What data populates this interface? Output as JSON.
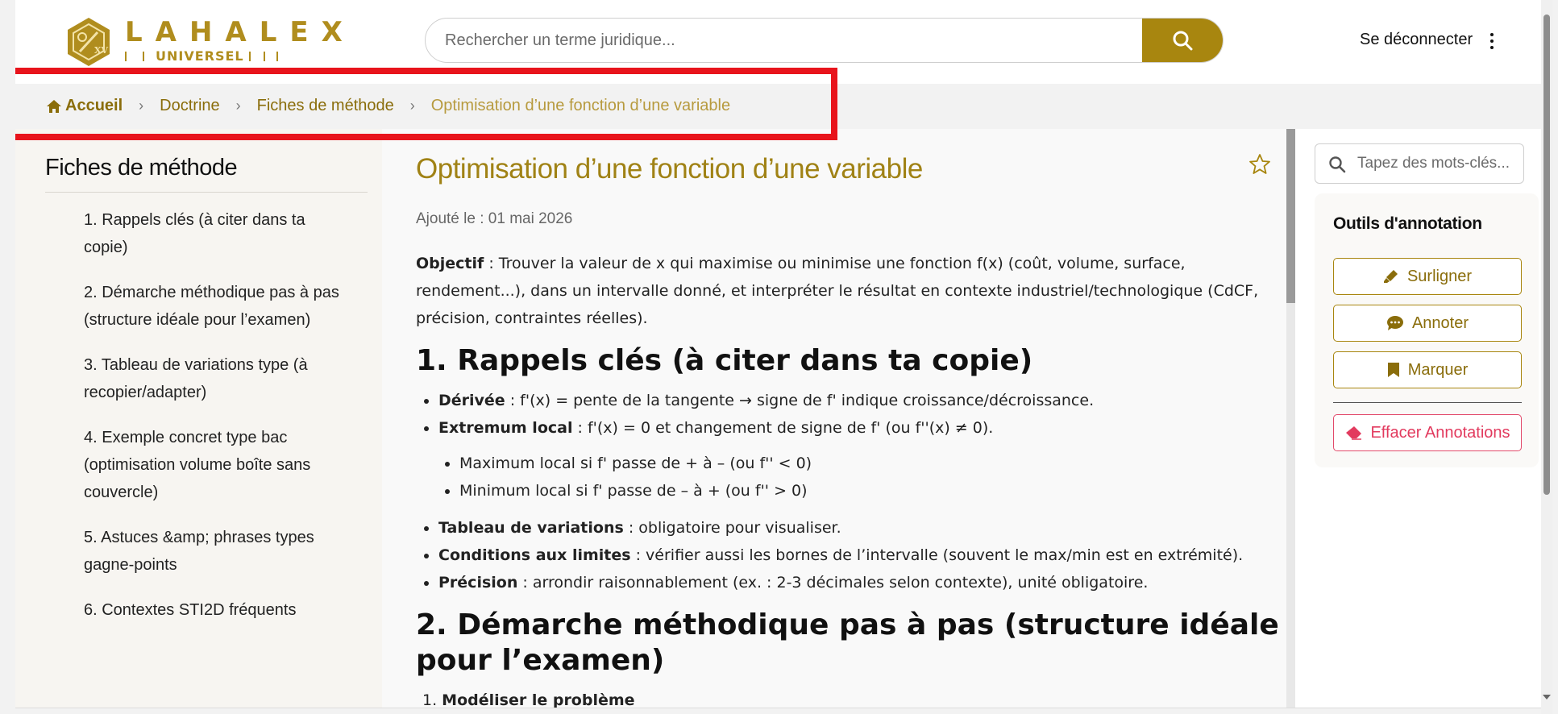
{
  "header": {
    "logo_word": "LAHALEX",
    "logo_sub": "UNIVERSEL",
    "search_placeholder": "Rechercher un terme juridique...",
    "logout_label": "Se déconnecter"
  },
  "breadcrumb": {
    "home": "Accueil",
    "items": [
      "Doctrine",
      "Fiches de méthode"
    ],
    "current": "Optimisation d’une fonction d’une variable"
  },
  "sidebar": {
    "title": "Fiches de méthode",
    "items": [
      "1. Rappels clés (à citer dans ta copie)",
      "2. Démarche méthodique pas à pas (structure idéale pour l’examen)",
      "3. Tableau de variations type (à recopier/adapter)",
      "4. Exemple concret type bac (optimisation volume boîte sans couvercle)",
      "5. Astuces &amp; phrases types gagne-points",
      "6. Contextes STI2D fréquents"
    ]
  },
  "article": {
    "title": "Optimisation d’une fonction d’une variable",
    "added": "Ajouté le : 01 mai 2026",
    "objective_label": "Objectif",
    "objective_text": " : Trouver la valeur de x qui maximise ou minimise une fonction f(x) (coût, volume, surface, rendement...), dans un intervalle donné, et interpréter le résultat en contexte industriel/technologique (CdCF, précision, contraintes réelles).",
    "h1": "1. Rappels clés (à citer dans ta copie)",
    "bullets": [
      {
        "label": "Dérivée",
        "text": " : f'(x) = pente de la tangente → signe de f' indique croissance/décroissance."
      },
      {
        "label": "Extremum local",
        "text": " : f'(x) = 0 et changement de signe de f' (ou f''(x) ≠ 0)."
      }
    ],
    "sub_bullets": [
      "Maximum local si f' passe de + à – (ou f'' < 0)",
      "Minimum local si f' passe de – à + (ou f'' > 0)"
    ],
    "bullets2": [
      {
        "label": "Tableau de variations",
        "text": " : obligatoire pour visualiser."
      },
      {
        "label": "Conditions aux limites",
        "text": " : vérifier aussi les bornes de l’intervalle (souvent le max/min est en extrémité)."
      },
      {
        "label": "Précision",
        "text": " : arrondir raisonnablement (ex. : 2-3 décimales selon contexte), unité obligatoire."
      }
    ],
    "h2": "2. Démarche méthodique pas à pas (structure idéale pour l’examen)",
    "step1_num": "1. ",
    "step1_label": "Modéliser le problème"
  },
  "tools": {
    "search_placeholder": "Tapez des mots-clés...",
    "title": "Outils d'annotation",
    "highlight": "Surligner",
    "annotate": "Annoter",
    "bookmark": "Marquer",
    "clear": "Effacer Annotations"
  },
  "colors": {
    "brand_gold": "#a8860f",
    "breadcrumb_link": "#8a6d0b",
    "danger": "#e23a5e",
    "focus_box": "#e8141c"
  }
}
